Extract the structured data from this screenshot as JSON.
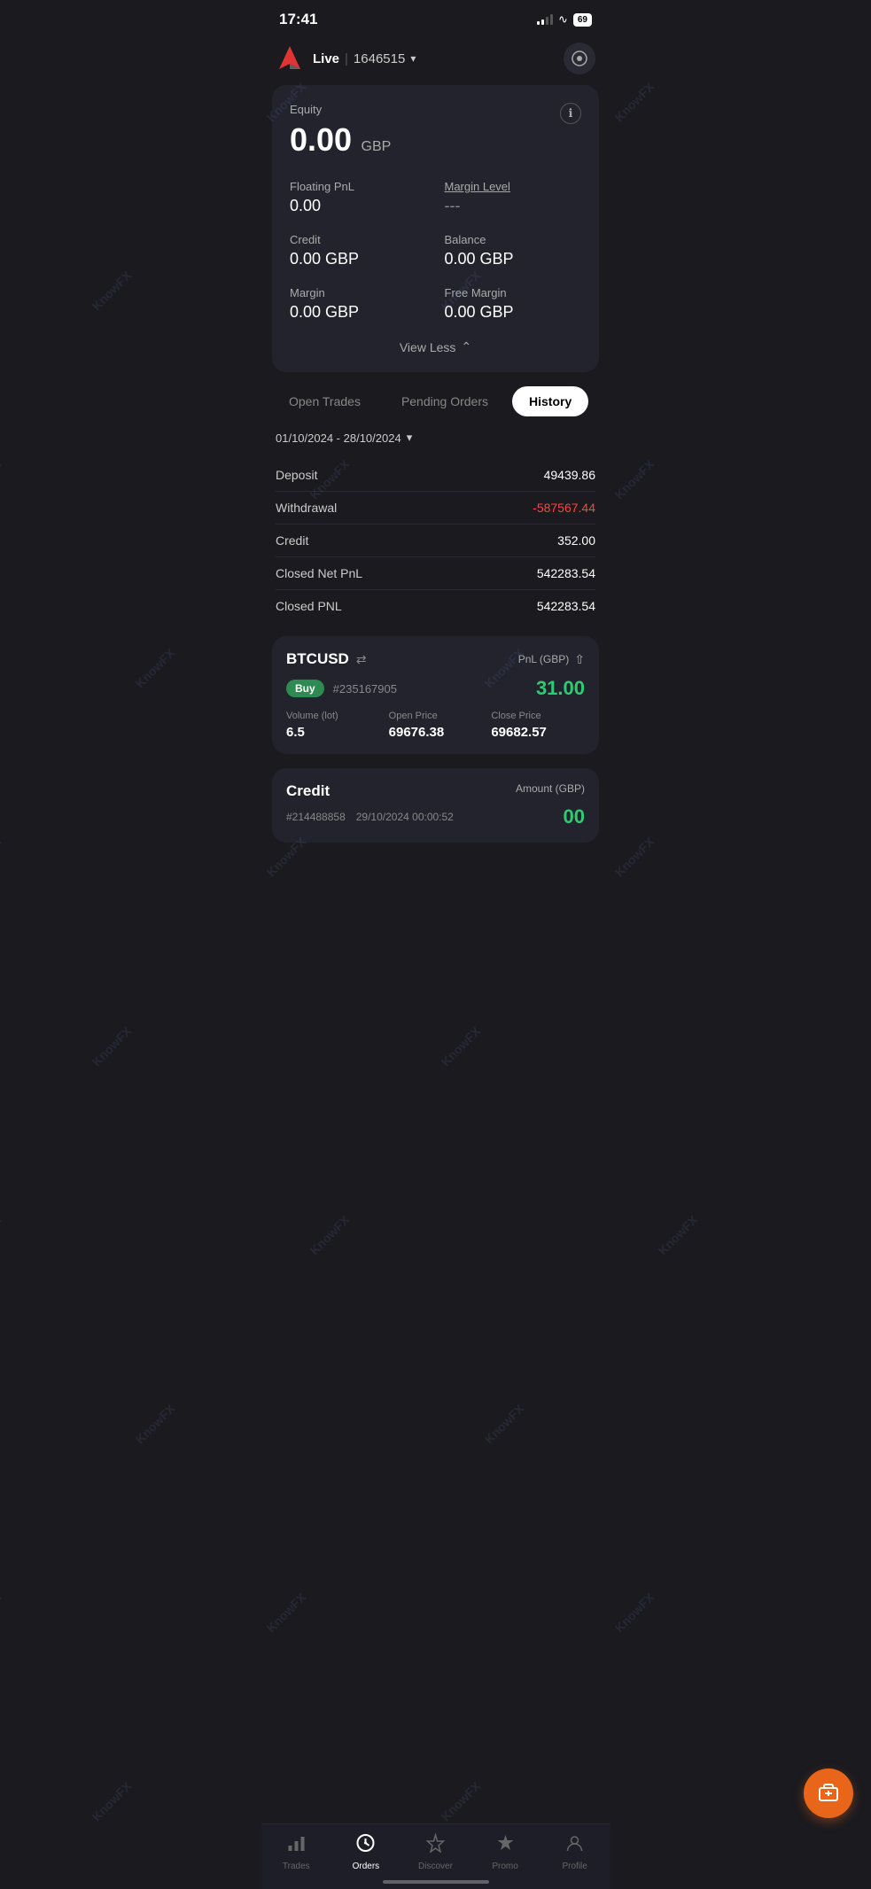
{
  "statusBar": {
    "time": "17:41",
    "battery": "69"
  },
  "header": {
    "accountType": "Live",
    "accountNumber": "1646515",
    "settingsIcon": "⚙"
  },
  "accountCard": {
    "equityLabel": "Equity",
    "equityValue": "0.00",
    "equityCurrency": "GBP",
    "floatingPnlLabel": "Floating PnL",
    "floatingPnlValue": "0.00",
    "marginLevelLabel": "Margin Level",
    "marginLevelValue": "---",
    "creditLabel": "Credit",
    "creditValue": "0.00 GBP",
    "balanceLabel": "Balance",
    "balanceValue": "0.00 GBP",
    "marginLabel": "Margin",
    "marginValue": "0.00 GBP",
    "freeMarginLabel": "Free Margin",
    "freeMarginValue": "0.00 GBP",
    "viewLessLabel": "View Less"
  },
  "tabs": [
    {
      "id": "open-trades",
      "label": "Open Trades",
      "active": false
    },
    {
      "id": "pending-orders",
      "label": "Pending Orders",
      "active": false
    },
    {
      "id": "history",
      "label": "History",
      "active": true
    }
  ],
  "history": {
    "dateRange": "01/10/2024 - 28/10/2024",
    "stats": [
      {
        "label": "Deposit",
        "value": "49439.86",
        "negative": false
      },
      {
        "label": "Withdrawal",
        "value": "-587567.44",
        "negative": true
      },
      {
        "label": "Credit",
        "value": "352.00",
        "negative": false
      },
      {
        "label": "Closed Net PnL",
        "value": "542283.54",
        "negative": false
      },
      {
        "label": "Closed PNL",
        "value": "542283.54",
        "negative": false
      }
    ]
  },
  "tradeCard": {
    "symbol": "BTCUSD",
    "swapIcon": "⇄",
    "pnlLabel": "PnL (GBP)",
    "direction": "Buy",
    "tradeId": "#235167905",
    "pnlValue": "31.00",
    "volumeLabel": "Volume (lot)",
    "volumeValue": "6.5",
    "openPriceLabel": "Open Price",
    "openPriceValue": "69676.38",
    "closePriceLabel": "Close Price",
    "closePriceValue": "69682.57"
  },
  "creditEntry": {
    "title": "Credit",
    "entryId": "#214488858",
    "entryDate": "29/10/2024 00:00:52",
    "amountLabel": "Amount (GBP)",
    "amountValue": "00"
  },
  "bottomNav": {
    "items": [
      {
        "id": "trades",
        "label": "Trades",
        "icon": "📊",
        "active": false
      },
      {
        "id": "orders",
        "label": "Orders",
        "icon": "⚡",
        "active": true
      },
      {
        "id": "discover",
        "label": "Discover",
        "icon": "◈",
        "active": false
      },
      {
        "id": "promo",
        "label": "Promo",
        "icon": "⚡",
        "active": false
      },
      {
        "id": "profile",
        "label": "Profile",
        "icon": "👤",
        "active": false
      }
    ]
  },
  "fab": {
    "icon": "💵"
  }
}
